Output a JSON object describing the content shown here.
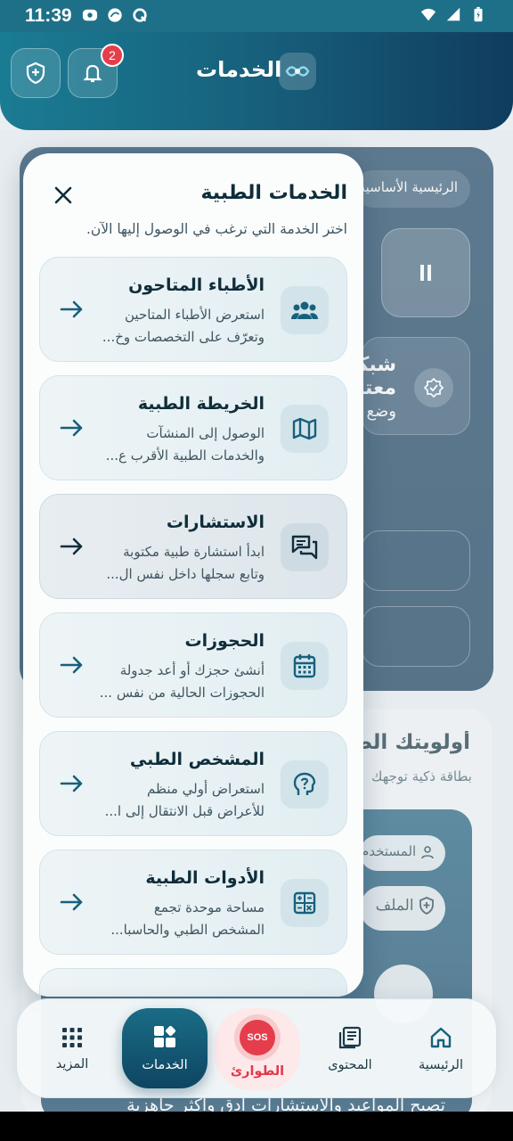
{
  "status_bar": {
    "time": "11:39"
  },
  "header": {
    "title": "الخدمات",
    "notification_count": "2"
  },
  "background": {
    "breadcrumb_chip": "الرئيسية الأساسية",
    "network_title": "شبكة",
    "network_line2": "معتمدة",
    "network_line3": "وضع",
    "priorities_title": "أولويتك الصحية",
    "priorities_subtitle": "بطاقة ذكية توجهك",
    "chip_user": "المستخدم",
    "chip_file": "الملف",
    "bottom_text": "تصبح المواعيد والاستشارات أدق وأكثر جاهزية"
  },
  "drawer": {
    "title": "الخدمات الطبية",
    "subtitle": "اختر الخدمة التي ترغب في الوصول إليها الآن.",
    "items": [
      {
        "title": "الأطباء المتاحون",
        "line1": "استعرض الأطباء المتاحين",
        "line2": "وتعرّف على التخصصات وخ...",
        "icon": "doctors-group-icon"
      },
      {
        "title": "الخريطة الطبية",
        "line1": "الوصول إلى المنشآت",
        "line2": "والخدمات الطبية الأقرب ع...",
        "icon": "map-icon"
      },
      {
        "title": "الاستشارات",
        "line1": "ابدأ استشارة طبية مكتوبة",
        "line2": "وتابع سجلها داخل نفس ال...",
        "icon": "chat-icon"
      },
      {
        "title": "الحجوزات",
        "line1": "أنشئ حجزك أو أعد جدولة",
        "line2": "الحجوزات الحالية من نفس ...",
        "icon": "calendar-icon"
      },
      {
        "title": "المشخص الطبي",
        "line1": "استعراض أولي منظم",
        "line2": "للأعراض قبل الانتقال إلى ا...",
        "icon": "diagnosis-head-icon"
      },
      {
        "title": "الأدوات الطبية",
        "line1": "مساحة موحدة تجمع",
        "line2": "المشخص الطبي والحاسبا...",
        "icon": "calculator-icon"
      }
    ]
  },
  "bottom_nav": {
    "home": "الرئيسية",
    "content": "المحتوى",
    "emergency": "الطوارئ",
    "sos": "SOS",
    "services": "الخدمات",
    "more": "المزيد"
  },
  "colors": {
    "primary": "#17607c",
    "accent_red": "#e53d4b",
    "card_bg": "#e8f1f4"
  }
}
